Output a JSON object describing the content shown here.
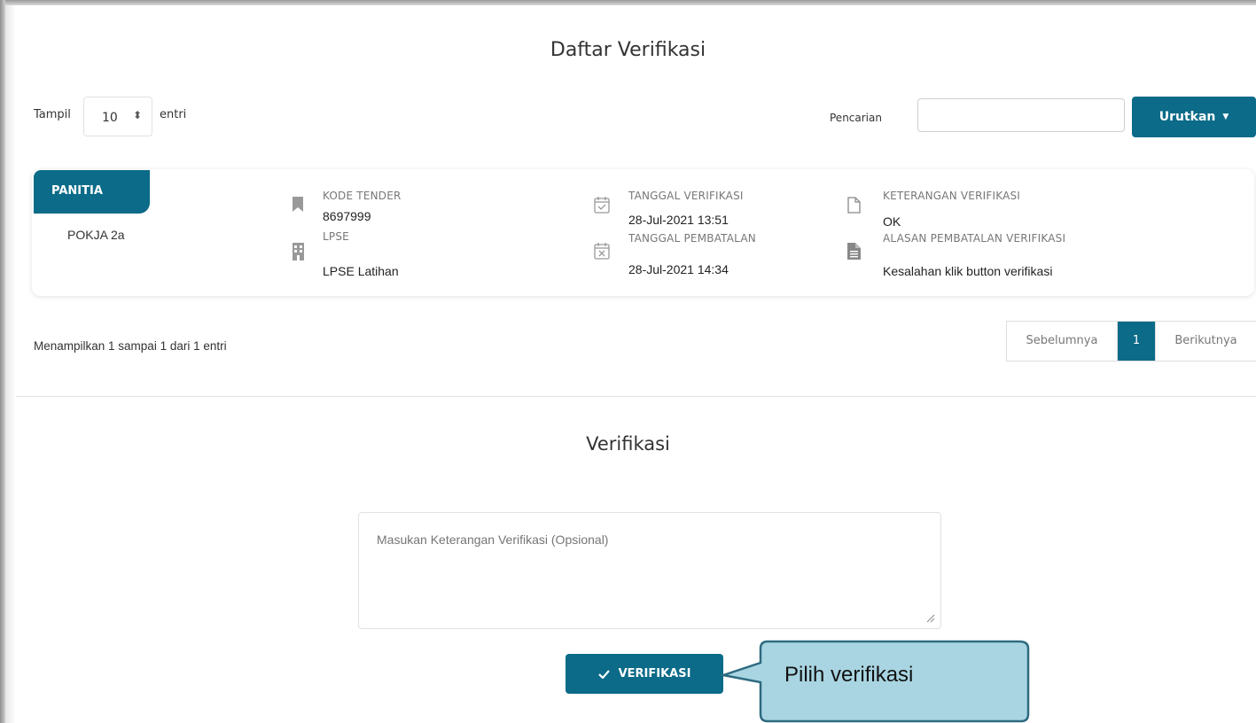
{
  "header": {
    "title": "Daftar Verifikasi"
  },
  "controls": {
    "show_label": "Tampil",
    "show_value": "10",
    "show_suffix": "entri",
    "search_label": "Pencarian",
    "search_value": "",
    "sort_label": "Urutkan"
  },
  "card": {
    "panitia_label": "PANITIA",
    "panitia_value": "POKJA 2a",
    "kode_tender_label": "KODE TENDER",
    "kode_tender_value": "8697999",
    "lpse_label": "LPSE",
    "lpse_value": "LPSE Latihan",
    "tanggal_verifikasi_label": "TANGGAL VERIFIKASI",
    "tanggal_verifikasi_value": "28-Jul-2021 13:51",
    "tanggal_pembatalan_label": "TANGGAL PEMBATALAN",
    "tanggal_pembatalan_value": "28-Jul-2021 14:34",
    "keterangan_label": "KETERANGAN VERIFIKASI",
    "keterangan_value": "OK",
    "alasan_label": "ALASAN PEMBATALAN VERIFIKASI",
    "alasan_value": "Kesalahan klik button verifikasi"
  },
  "footer": {
    "info": "Menampilkan 1 sampai 1 dari 1 entri",
    "prev": "Sebelumnya",
    "current_page": "1",
    "next": "Berikutnya"
  },
  "verification": {
    "title": "Verifikasi",
    "placeholder": "Masukan Keterangan Verifikasi (Opsional)",
    "button_label": "VERIFIKASI",
    "button_icon": "check-icon"
  },
  "callout": {
    "text": "Pilih verifikasi"
  },
  "colors": {
    "accent": "#0b6b88",
    "callout_fill": "#a9d5e2",
    "callout_border": "#2e6b80"
  }
}
